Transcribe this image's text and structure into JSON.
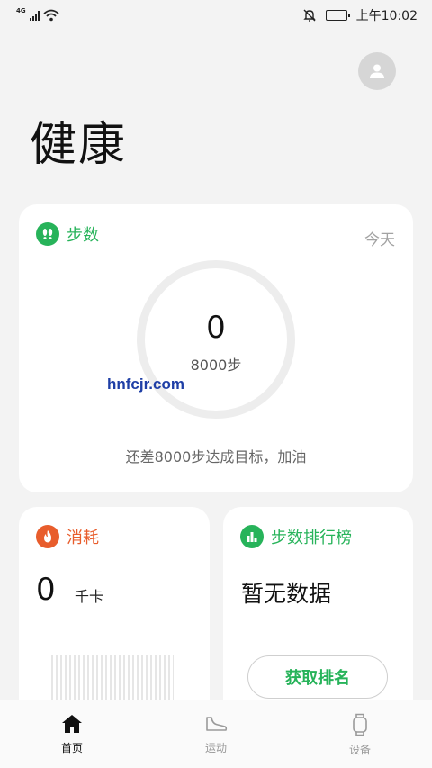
{
  "status_bar": {
    "network": "4G",
    "time": "上午10:02"
  },
  "header": {
    "title": "健康",
    "avatar_icon": "user-avatar-icon"
  },
  "steps_card": {
    "title": "步数",
    "date_label": "今天",
    "count": "0",
    "goal": "8000步",
    "progress": 0,
    "message": "还差8000步达成目标，加油",
    "accent": "#27b35a"
  },
  "watermark": "hnfcjr.com",
  "calories_card": {
    "title": "消耗",
    "value": "0",
    "unit": "千卡",
    "accent": "#e85d2c"
  },
  "rank_card": {
    "title": "步数排行榜",
    "empty_text": "暂无数据",
    "button_label": "获取排名",
    "accent": "#27b35a"
  },
  "bottom_nav": {
    "items": [
      {
        "label": "首页",
        "icon": "home-icon",
        "active": true
      },
      {
        "label": "运动",
        "icon": "shoe-icon",
        "active": false
      },
      {
        "label": "设备",
        "icon": "watch-icon",
        "active": false
      }
    ]
  }
}
